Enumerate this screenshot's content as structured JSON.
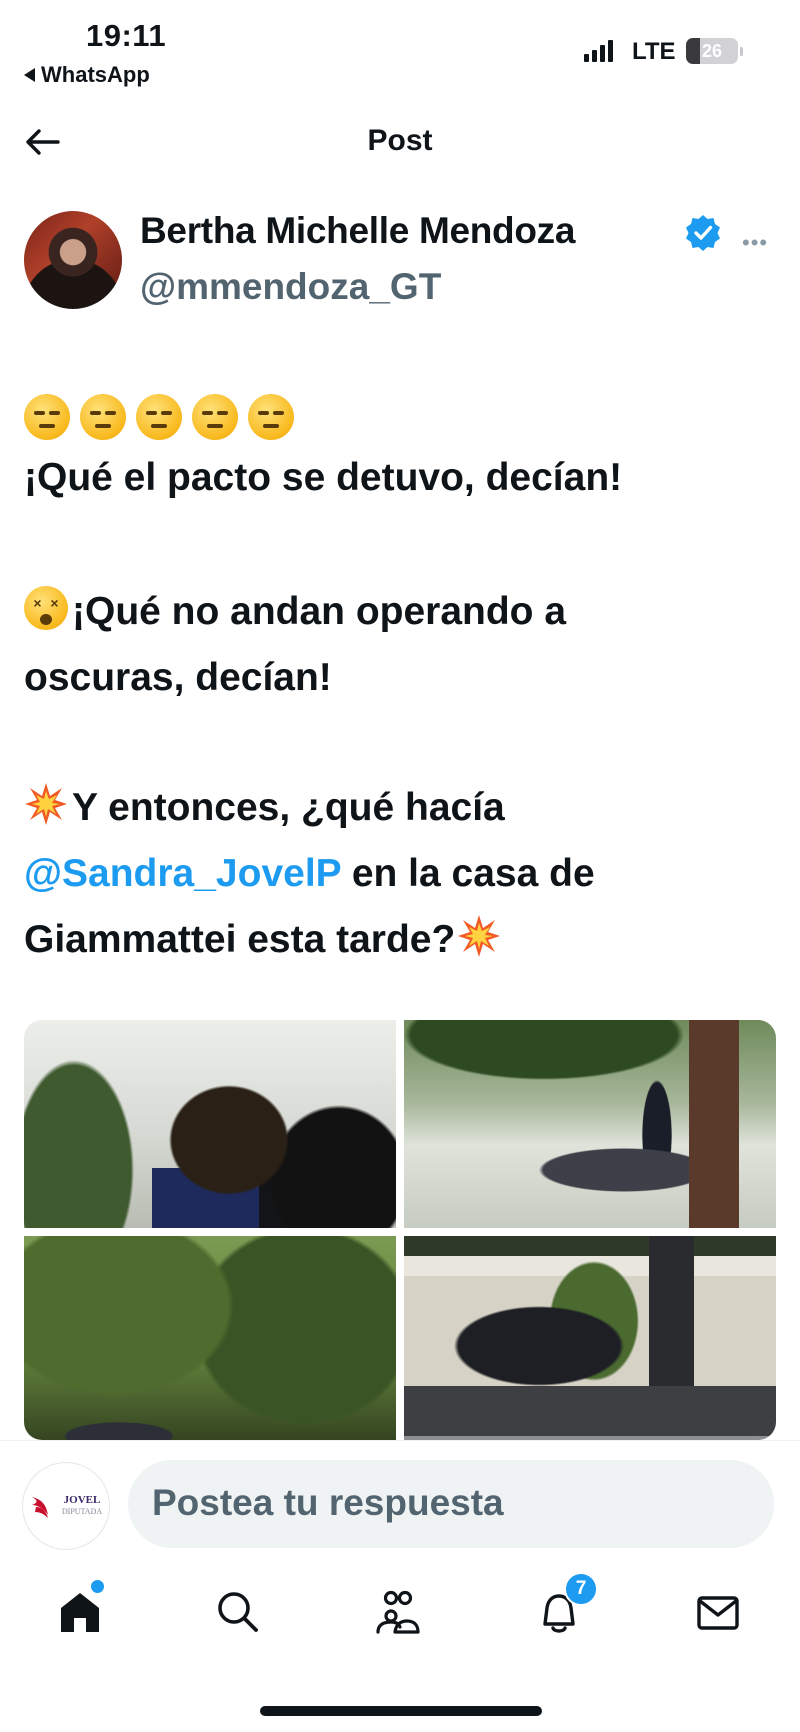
{
  "status_bar": {
    "time": "19:11",
    "back_app": "WhatsApp",
    "network": "LTE",
    "battery": "26",
    "battery_level": 0.26
  },
  "header": {
    "title": "Post"
  },
  "author": {
    "name": "Bertha Michelle Mendoza",
    "handle": "@mmendoza_GT",
    "verified": true
  },
  "post": {
    "line1": "¡Qué el pacto se detuvo, decían!",
    "para2_line1": "¡Qué no andan operando a",
    "para2_line2": "oscuras, decían!",
    "para3_line1": "Y entonces, ¿qué hacía",
    "mention": "@Sandra_JovelP",
    "para3_line2_rest": " en la casa de",
    "para3_line3": "Giammattei esta tarde?"
  },
  "reply": {
    "placeholder": "Postea tu respuesta",
    "avatar_brand": "JOVEL",
    "avatar_sub": "DIPUTADA"
  },
  "tab_bar": {
    "notifications_count": "7"
  },
  "colors": {
    "accent": "#1d9bf0",
    "text": "#0f1419",
    "secondary": "#536471"
  }
}
